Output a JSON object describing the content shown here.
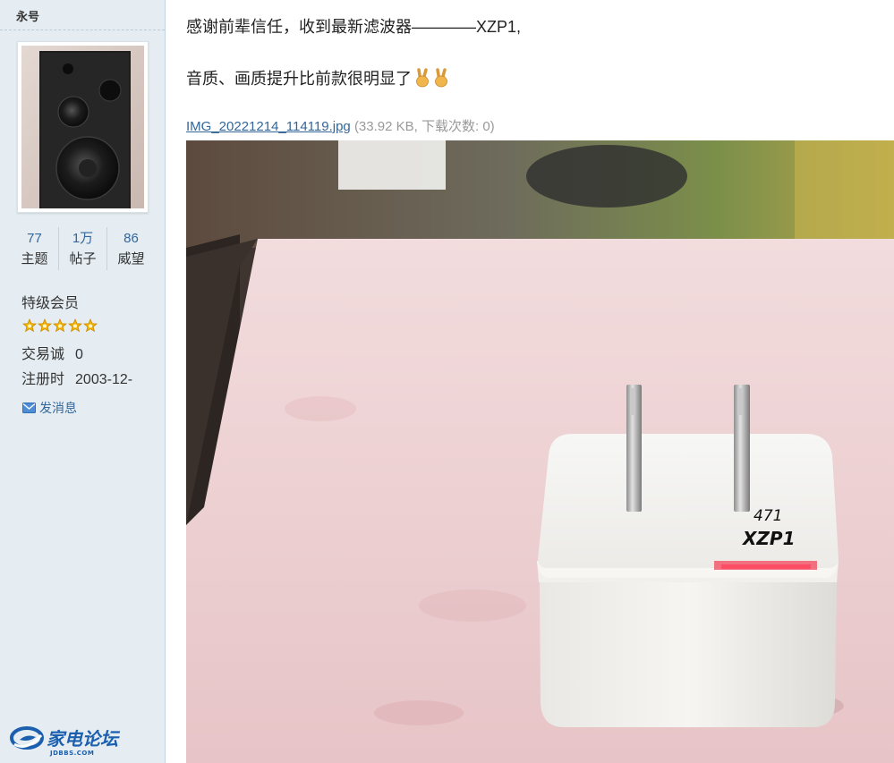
{
  "user": {
    "name": "永号",
    "stats": [
      {
        "value": "77",
        "label": "主题"
      },
      {
        "value": "1万",
        "label": "帖子"
      },
      {
        "value": "86",
        "label": "威望"
      }
    ],
    "group": "特级会员",
    "rating_stars": 5,
    "trade_label": "交易诚",
    "trade_value": "0",
    "reg_label": "注册时",
    "reg_value": "2003-12-",
    "pm_label": "发消息"
  },
  "post": {
    "line1": "感谢前辈信任，收到最新滤波器————XZP1,",
    "line2": "音质、画质提升比前款很明显了",
    "emoji_count": 2,
    "attachment": {
      "name": "IMG_20221214_114119.jpg",
      "meta": "(33.92 KB, 下载次数: 0)"
    },
    "photo_handwriting_1": "471",
    "photo_handwriting_2": "XZP1"
  },
  "site": {
    "logo_text": "家电论坛",
    "logo_domain": "JDBBS.COM"
  },
  "colors": {
    "sidebar_bg": "#e5edf2",
    "link": "#336699",
    "star": "#f5b400"
  }
}
